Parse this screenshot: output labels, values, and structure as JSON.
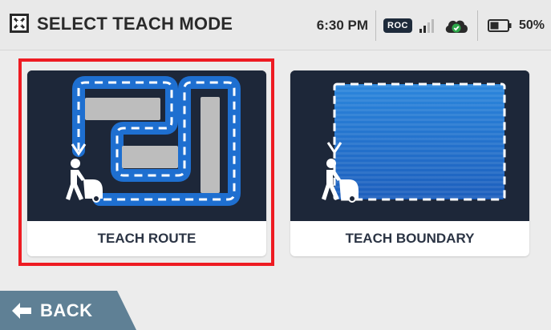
{
  "header": {
    "title": "SELECT TEACH MODE",
    "time": "6:30 PM",
    "badge": "ROC",
    "battery_pct": "50%",
    "battery_level": 0.5
  },
  "cards": [
    {
      "label": "TEACH ROUTE",
      "selected": true
    },
    {
      "label": "TEACH BOUNDARY",
      "selected": false
    }
  ],
  "back": {
    "label": "BACK"
  },
  "colors": {
    "accent_blue": "#1e6fd0",
    "card_art_bg": "#1d2739",
    "selection": "#ee1b22",
    "back_bg": "#5f8095",
    "cloud_ok": "#2ea84a"
  },
  "icons": [
    "app-logo-icon",
    "signal-bars-icon",
    "cloud-check-icon",
    "battery-icon",
    "arrow-left-icon",
    "route-illustration-icon",
    "boundary-illustration-icon",
    "operator-scrubber-icon"
  ]
}
